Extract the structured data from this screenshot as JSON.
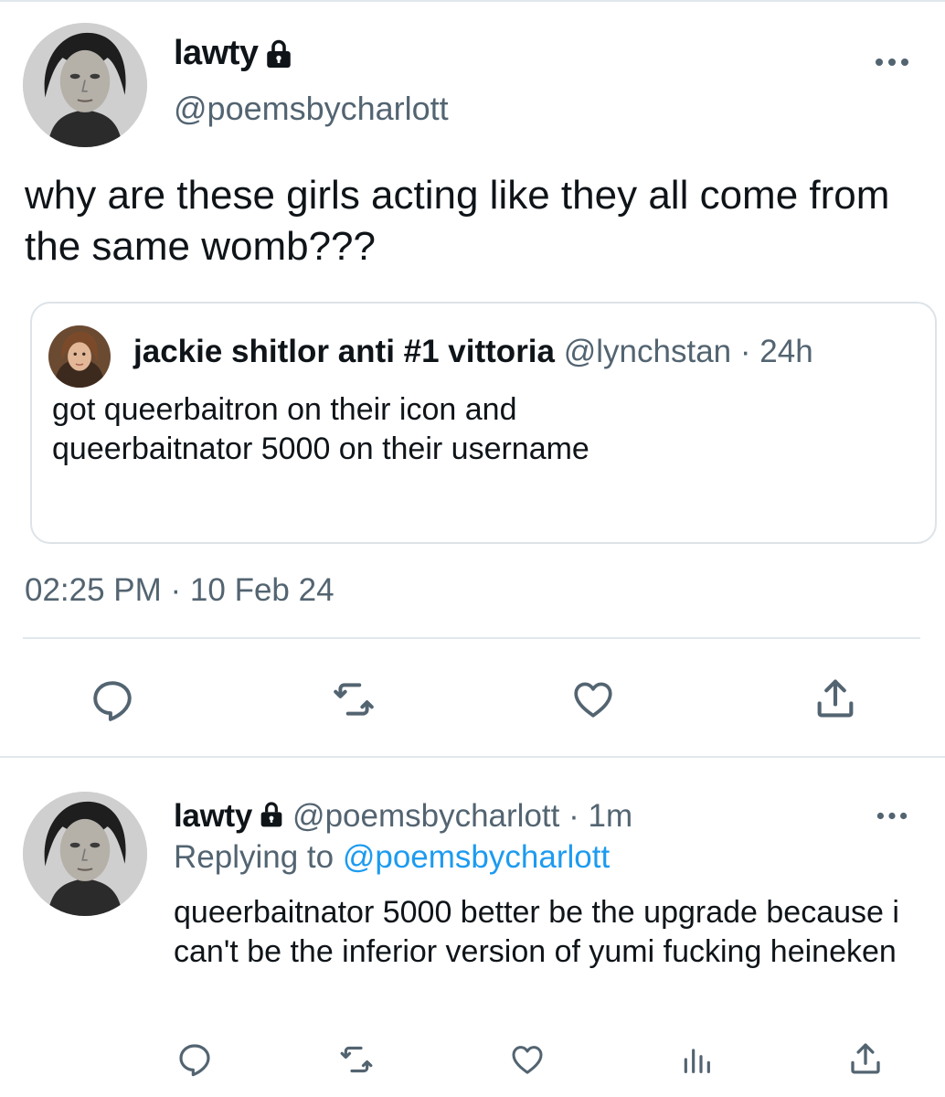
{
  "main_tweet": {
    "display_name": "lawty",
    "handle": "@poemsbycharlott",
    "text": "why are these girls acting like they all come from the same womb???",
    "timestamp": "02:25 PM · 10 Feb 24",
    "more_icon": "more-horizontal-icon",
    "lock_icon": "lock-icon",
    "actions": [
      {
        "name": "reply",
        "icon": "reply-icon"
      },
      {
        "name": "retweet",
        "icon": "retweet-icon"
      },
      {
        "name": "like",
        "icon": "heart-icon"
      },
      {
        "name": "share",
        "icon": "share-icon"
      }
    ]
  },
  "quoted_tweet": {
    "display_name": "jackie shitlor anti #1 vittoria",
    "handle": "@lynchstan",
    "separator": "·",
    "time": "24h",
    "text": "got queerbaitron on their icon and queerbaitnator 5000 on their username"
  },
  "reply_tweet": {
    "display_name": "lawty",
    "handle": "@poemsbycharlott",
    "separator": "·",
    "time": "1m",
    "replying_label": "Replying to",
    "replying_to": "@poemsbycharlott",
    "text": "queerbaitnator 5000 better be the upgrade because i can't be the inferior version of yumi fucking heineken",
    "actions": [
      {
        "name": "reply",
        "icon": "reply-icon"
      },
      {
        "name": "retweet",
        "icon": "retweet-icon"
      },
      {
        "name": "like",
        "icon": "heart-icon"
      },
      {
        "name": "analytics",
        "icon": "analytics-icon"
      },
      {
        "name": "share",
        "icon": "share-icon"
      }
    ]
  },
  "colors": {
    "text": "#0f1419",
    "secondary": "#536471",
    "link": "#1d9bf0",
    "border": "#e1e8ed"
  }
}
